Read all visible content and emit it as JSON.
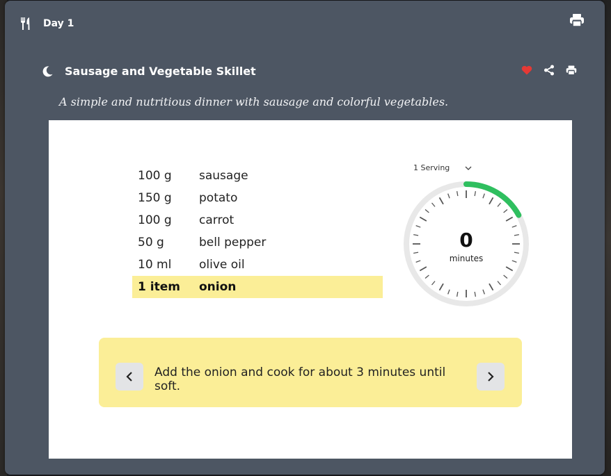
{
  "day": {
    "title": "Day 1"
  },
  "recipe": {
    "title": "Sausage and Vegetable Skillet",
    "subtitle": "A simple and nutritious dinner with sausage and colorful vegetables.",
    "favorited": true
  },
  "ingredients": [
    {
      "qty": "100 g",
      "name": "sausage"
    },
    {
      "qty": "150 g",
      "name": "potato"
    },
    {
      "qty": "100 g",
      "name": "carrot"
    },
    {
      "qty": "50 g",
      "name": "bell pepper"
    },
    {
      "qty": "10 ml",
      "name": "olive oil"
    },
    {
      "qty": "1 item",
      "name": "onion",
      "highlighted": true
    }
  ],
  "serving": {
    "selected": "1 Serving"
  },
  "timer": {
    "value": "0",
    "unit": "minutes",
    "progress_fraction": 0.17
  },
  "step": {
    "text": "Add the onion and cook for about 3 minutes until soft."
  },
  "colors": {
    "card_bg": "#4d5663",
    "highlight": "#fbee97",
    "timer_progress": "#2fbf5f",
    "heart": "#e53935"
  },
  "icons": {
    "day": "utensils-icon",
    "meal": "moon-icon",
    "favorite": "heart-icon",
    "share": "share-icon",
    "print": "print-icon",
    "prev": "chevron-left-icon",
    "next": "chevron-right-icon",
    "dropdown": "chevron-down-icon"
  }
}
